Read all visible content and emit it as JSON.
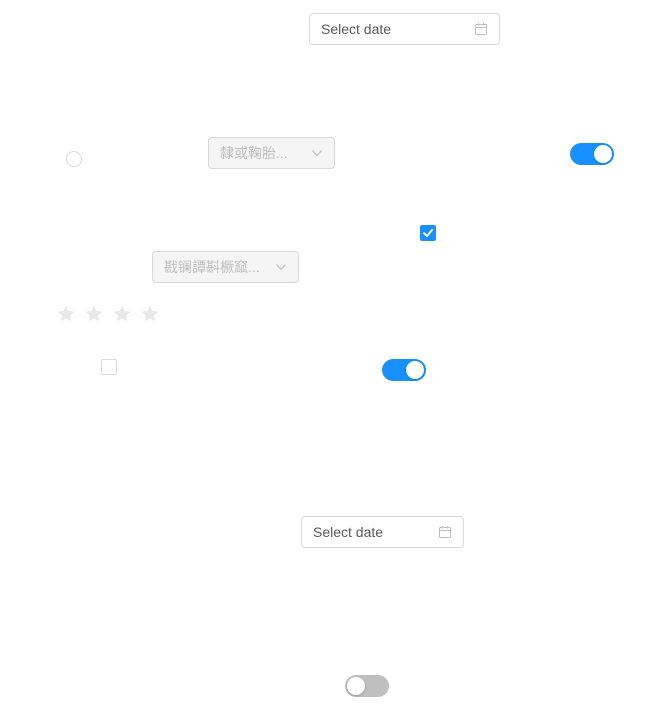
{
  "colors": {
    "accent": "#1890ff",
    "border": "#d9d9d9",
    "disabled_bg": "#f5f5f5",
    "disabled_text": "#bfbfbf",
    "star_inactive": "#e8e8e8",
    "switch_off": "#bfbfbf"
  },
  "date_pickers": [
    {
      "placeholder": "Select date",
      "icon": "calendar-icon"
    },
    {
      "placeholder": "Select date",
      "icon": "calendar-icon"
    }
  ],
  "selects": [
    {
      "value": "隸或鞠胎...",
      "icon": "chevron-down-icon",
      "disabled": true
    },
    {
      "value": "戡镧譚斟橛窳...",
      "icon": "chevron-down-icon",
      "disabled": true
    }
  ],
  "radio": {
    "checked": false
  },
  "checkboxes": [
    {
      "checked": true
    },
    {
      "checked": false
    }
  ],
  "switches": [
    {
      "on": true
    },
    {
      "on": true
    },
    {
      "on": false
    }
  ],
  "rate": {
    "value": 0,
    "count": 4
  }
}
